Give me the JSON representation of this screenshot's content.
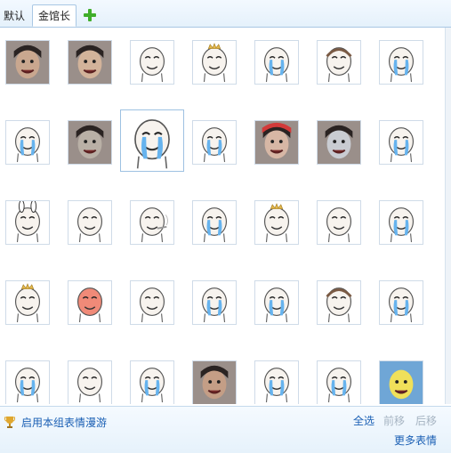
{
  "tabs": [
    {
      "label": "默认",
      "active": false
    },
    {
      "label": "金馆长",
      "active": true
    }
  ],
  "add_tab_icon": "plus-icon",
  "grid": {
    "rows": [
      [
        "photo-girl-face",
        "photo-man-face",
        "cartoon-cute-face",
        "cartoon-crown-face",
        "cartoon-crying-face",
        "cartoon-photo-face",
        "cartoon-crying-face"
      ],
      [
        "cartoon-crying-face",
        "photo-dog-face",
        "cartoon-crying-face-enlarged",
        "cartoon-crying-face",
        "photo-santa-hat-face",
        "photo-shark-face",
        "cartoon-crying-face"
      ],
      [
        "cartoon-bunny-face",
        "cartoon-face",
        "cartoon-smoking-face",
        "cartoon-crying-face",
        "cartoon-crown-face",
        "cartoon-face",
        "cartoon-crying-face"
      ],
      [
        "cartoon-crown-face",
        "cartoon-pink-face",
        "cartoon-face",
        "cartoon-crying-face",
        "cartoon-crying-face",
        "cartoon-photo-face",
        "cartoon-crying-face"
      ],
      [
        "cartoon-crying-face",
        "cartoon-cute-face",
        "cartoon-crying-face",
        "photo-laughing-face",
        "cartoon-crying-face",
        "cartoon-crying-face",
        "photo-sponge-face"
      ]
    ]
  },
  "footer": {
    "roam_icon": "trophy-icon",
    "roam_label": "启用本组表情漫游",
    "select_all": "全选",
    "prev": "前移",
    "next": "后移",
    "more": "更多表情"
  },
  "colors": {
    "link": "#1a5fb4",
    "disabled": "#a6b4c2",
    "tear": "#66b3ee",
    "crown": "#e2b64a",
    "cell_border": "#cfdbe8"
  }
}
